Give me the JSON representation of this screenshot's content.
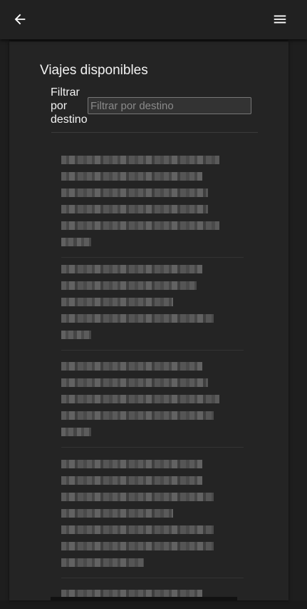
{
  "page": {
    "title": "Viajes disponibles"
  },
  "appbar": {
    "back_icon": "arrow-left-icon",
    "menu_icon": "hamburger-menu-icon"
  },
  "filter": {
    "label": "Filtrar por destino",
    "placeholder": "Filtrar por destino",
    "value": ""
  },
  "trips": [
    {
      "lines": [
        "▇▇▇▇▇▇▇▇▇▇▇▇▇▇▇▇",
        "▇▇▇▇▇▇▇▇▇▇▇▇▇▇",
        "▇▇▇▇▇▇▇▇▇▇▇▇▇▇▇",
        "▇▇▇▇▇▇▇▇▇▇▇▇▇▇▇",
        "▇▇▇▇▇▇▇▇▇▇▇▇▇▇▇▇",
        "▇▇▇"
      ]
    },
    {
      "lines": [
        "▇▇▇▇▇▇▇▇▇▇▇▇▇▇",
        "▇▇▇▇▇▇▇▇▇▇▇▇▇▇",
        "▇▇▇▇▇▇▇▇▇▇▇",
        "▇▇▇▇▇▇▇▇▇▇▇▇▇▇▇",
        "▇▇▇"
      ]
    },
    {
      "lines": [
        "▇▇▇▇▇▇▇▇▇▇▇▇▇▇",
        "▇▇▇▇▇▇▇▇▇▇▇▇▇▇▇",
        "▇▇▇▇▇▇▇▇▇▇▇▇▇▇▇",
        "▇▇▇▇▇▇▇▇▇▇▇▇▇▇▇",
        "▇▇▇"
      ]
    },
    {
      "lines": [
        "▇▇▇▇▇▇▇▇▇▇▇▇▇▇",
        "▇▇▇▇▇▇▇▇▇▇▇▇▇▇",
        "▇▇▇▇▇▇▇▇▇▇▇▇▇▇▇",
        "▇▇▇▇▇▇▇▇▇▇▇",
        "▇▇▇▇▇▇▇▇▇▇▇▇▇▇▇",
        "▇▇▇▇▇▇▇▇▇▇▇▇▇▇▇",
        "▇▇▇▇▇▇▇▇"
      ]
    },
    {
      "lines": [
        "▇▇▇▇▇▇▇▇▇▇▇▇▇▇"
      ]
    }
  ]
}
